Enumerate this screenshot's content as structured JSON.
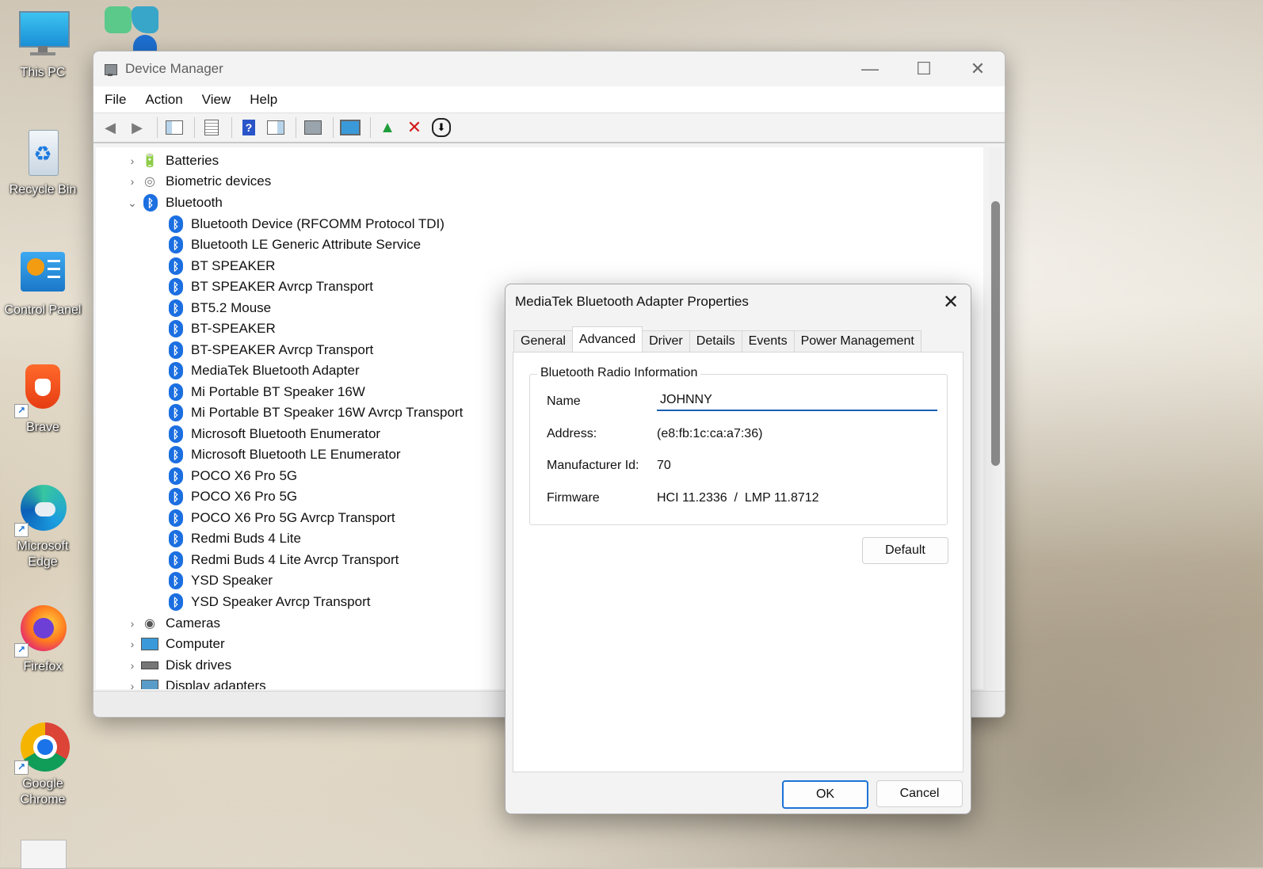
{
  "desktop": {
    "icons": [
      {
        "label_1": "This PC",
        "label_2": ""
      },
      {
        "label_1": "Recycle Bin",
        "label_2": ""
      },
      {
        "label_1": "Control Panel",
        "label_2": ""
      },
      {
        "label_1": "Brave",
        "label_2": ""
      },
      {
        "label_1": "Microsoft",
        "label_2": "Edge"
      },
      {
        "label_1": "Firefox",
        "label_2": ""
      },
      {
        "label_1": "Google",
        "label_2": "Chrome"
      }
    ]
  },
  "device_manager": {
    "title": "Device Manager",
    "menu": [
      "File",
      "Action",
      "View",
      "Help"
    ],
    "tree": {
      "categories_top": [
        {
          "label": "Batteries",
          "expanded": false
        },
        {
          "label": "Biometric devices",
          "expanded": false
        },
        {
          "label": "Bluetooth",
          "expanded": true
        }
      ],
      "bluetooth_devices": [
        "Bluetooth Device (RFCOMM Protocol TDI)",
        "Bluetooth LE Generic Attribute Service",
        "BT SPEAKER",
        "BT SPEAKER Avrcp Transport",
        "BT5.2 Mouse",
        "BT-SPEAKER",
        "BT-SPEAKER Avrcp Transport",
        "MediaTek Bluetooth Adapter",
        "Mi Portable BT Speaker 16W",
        "Mi Portable BT Speaker 16W Avrcp Transport",
        "Microsoft Bluetooth Enumerator",
        "Microsoft Bluetooth LE Enumerator",
        "POCO X6 Pro 5G",
        "POCO X6 Pro 5G",
        "POCO X6 Pro 5G Avrcp Transport",
        "Redmi Buds 4 Lite",
        "Redmi Buds 4 Lite Avrcp Transport",
        "YSD Speaker",
        "YSD Speaker Avrcp Transport"
      ],
      "categories_bottom": [
        {
          "label": "Cameras"
        },
        {
          "label": "Computer"
        },
        {
          "label": "Disk drives"
        },
        {
          "label": "Display adapters"
        }
      ]
    }
  },
  "dialog": {
    "title": "MediaTek Bluetooth Adapter Properties",
    "tabs": [
      "General",
      "Advanced",
      "Driver",
      "Details",
      "Events",
      "Power Management"
    ],
    "active_tab": "Advanced",
    "group_label": "Bluetooth Radio Information",
    "fields": {
      "name_label": "Name",
      "name_value": "JOHNNY",
      "address_label": "Address:",
      "address_value": "(e8:fb:1c:ca:a7:36)",
      "manufacturer_label": "Manufacturer Id:",
      "manufacturer_value": "70",
      "firmware_label": "Firmware",
      "firmware_value": "HCI 11.2336  /  LMP 11.8712"
    },
    "buttons": {
      "default": "Default",
      "ok": "OK",
      "cancel": "Cancel"
    }
  },
  "colors": {
    "accent": "#1a73d8",
    "bluetooth": "#1c6fe0"
  }
}
